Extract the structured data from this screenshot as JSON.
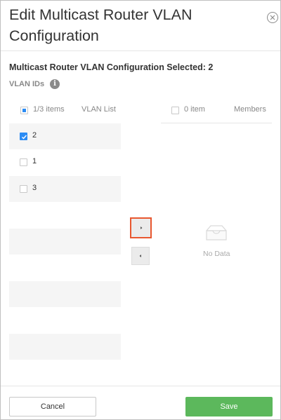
{
  "dialog": {
    "title": "Edit Multicast Router VLAN Configuration",
    "close_icon": "close-circle-icon"
  },
  "section": {
    "selected_title": "Multicast Router VLAN Configuration Selected: 2",
    "vlan_ids_label": "VLAN IDs",
    "info_icon": "info-icon",
    "info_glyph": "i"
  },
  "left_list": {
    "count_label": "1/3 items",
    "header": "VLAN List",
    "select_all_state": "partial",
    "items": [
      {
        "label": "2",
        "checked": true
      },
      {
        "label": "1",
        "checked": false
      },
      {
        "label": "3",
        "checked": false
      }
    ]
  },
  "right_list": {
    "count_label": "0 item",
    "header": "Members",
    "empty_text": "No Data",
    "empty_icon": "inbox-icon"
  },
  "transfer": {
    "to_right_icon": "caret-right-icon",
    "to_left_icon": "caret-left-icon"
  },
  "footer": {
    "cancel_label": "Cancel",
    "save_label": "Save"
  },
  "colors": {
    "accent": "#2c8cf4",
    "save": "#5cb85c",
    "focus_outline": "#e8572f"
  }
}
